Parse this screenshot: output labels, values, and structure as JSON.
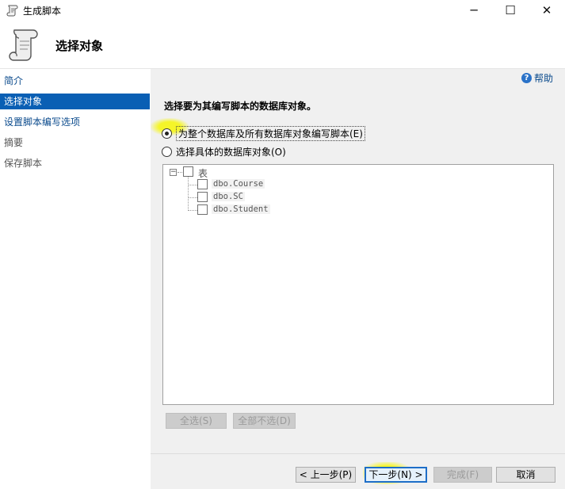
{
  "window": {
    "title": "生成脚本",
    "minimize_glyph": "─",
    "maximize_glyph": "☐",
    "close_glyph": "✕"
  },
  "header": {
    "title": "选择对象",
    "icon": "scroll-icon"
  },
  "sidebar": {
    "items": [
      {
        "label": "简介",
        "state": "link"
      },
      {
        "label": "选择对象",
        "state": "selected"
      },
      {
        "label": "设置脚本编写选项",
        "state": "link"
      },
      {
        "label": "摘要",
        "state": "inactive"
      },
      {
        "label": "保存脚本",
        "state": "inactive"
      }
    ]
  },
  "main": {
    "help_label": "帮助",
    "help_icon_glyph": "?",
    "prompt": "选择要为其编写脚本的数据库对象。",
    "options": [
      {
        "label": "为整个数据库及所有数据库对象编写脚本(E)",
        "checked": true
      },
      {
        "label": "选择具体的数据库对象(O)",
        "checked": false
      }
    ],
    "tree": {
      "root": {
        "label": "表",
        "expander": "−",
        "checked": false
      },
      "children": [
        {
          "label": "dbo.Course",
          "checked": false
        },
        {
          "label": "dbo.SC",
          "checked": false
        },
        {
          "label": "dbo.Student",
          "checked": false
        }
      ]
    },
    "select_all_label": "全选(S)",
    "deselect_all_label": "全部不选(D)"
  },
  "footer": {
    "prev_label": "< 上一步(P)",
    "next_label": "下一步(N) >",
    "finish_label": "完成(F)",
    "cancel_label": "取消"
  },
  "colors": {
    "selected_bg": "#0a5fb4",
    "link": "#0a4a8c",
    "highlight": "#f5f51e",
    "panel_bg": "#f0f0f0"
  }
}
